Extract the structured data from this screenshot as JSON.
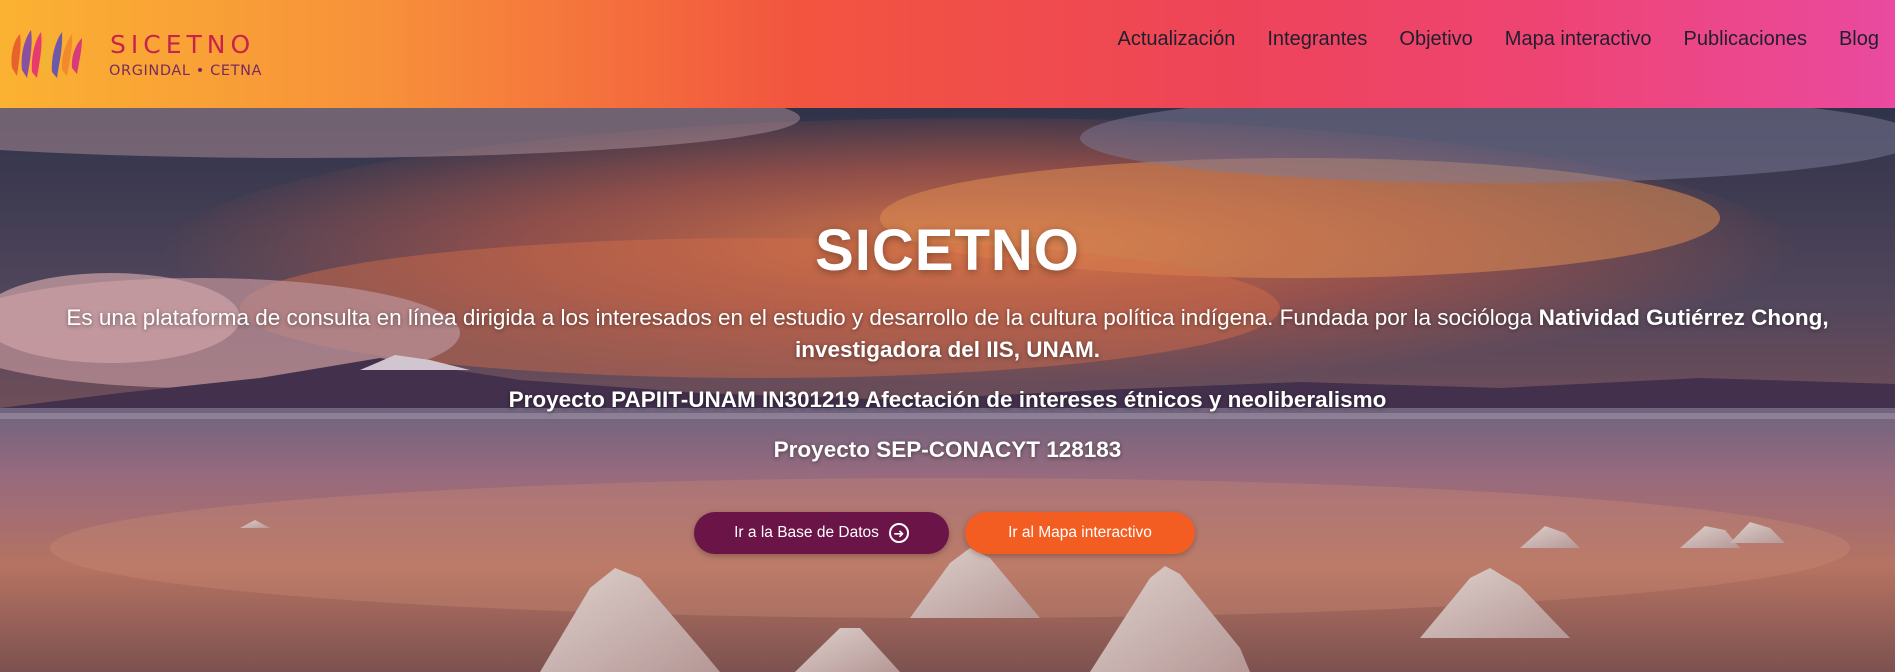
{
  "brand": {
    "name": "SICETNO",
    "subtitle": "ORGINDAL • CETNA",
    "logo_icon": "brush-strokes-logo-icon"
  },
  "nav": {
    "items": [
      {
        "label": "Actualización"
      },
      {
        "label": "Integrantes"
      },
      {
        "label": "Objetivo"
      },
      {
        "label": "Mapa interactivo"
      },
      {
        "label": "Publicaciones"
      },
      {
        "label": "Blog"
      }
    ]
  },
  "hero": {
    "title": "SICETNO",
    "description_prefix": "Es una plataforma de consulta en línea dirigida a los interesados en el estudio y desarrollo de la cultura política indígena. Fundada por la socióloga ",
    "description_bold": "Natividad Gutiérrez Chong, investigadora del IIS, UNAM.",
    "project_1": "Proyecto PAPIIT-UNAM IN301219 Afectación de intereses étnicos y neoliberalismo",
    "project_2": "Proyecto SEP-CONACYT 128183",
    "background": "salt-flat-sunset-photo"
  },
  "buttons": {
    "database_label": "Ir a la Base de Datos",
    "database_icon": "arrow-right-circle-icon",
    "map_label": "Ir al Mapa interactivo"
  },
  "colors": {
    "header_gradient": [
      "#fbb232",
      "#f2553f",
      "#ee4459",
      "#ea4aa0"
    ],
    "database_button": "#6b1448",
    "map_button": "#f35d22",
    "brand_text": "#c8234a"
  }
}
